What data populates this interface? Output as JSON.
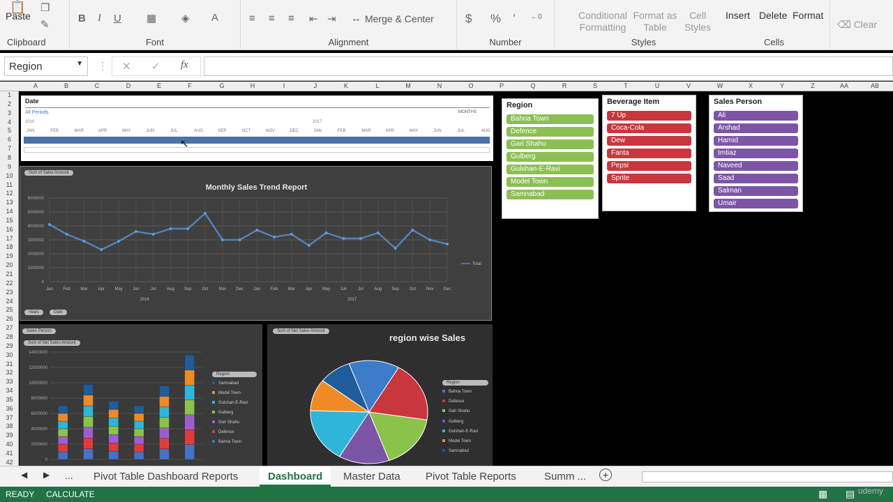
{
  "ribbon": {
    "paste": "Paste",
    "clipboard": "Clipboard",
    "font": "Font",
    "alignment": "Alignment",
    "merge_center": "Merge & Center",
    "number": "Number",
    "currency": "$",
    "percent": "%",
    "comma": "’",
    "conditional1": "Conditional",
    "conditional2": "Formatting",
    "format_table1": "Format as",
    "format_table2": "Table",
    "cell_styles1": "Cell",
    "cell_styles2": "Styles",
    "styles": "Styles",
    "insert": "Insert",
    "delete": "Delete",
    "format": "Format",
    "cells": "Cells",
    "clear": "Clear",
    "bold": "B",
    "italic": "I",
    "underline": "U"
  },
  "formula_bar": {
    "name_box": "Region",
    "cancel": "✕",
    "enter": "✓",
    "fx": "fx",
    "value": ""
  },
  "columns": [
    "A",
    "B",
    "C",
    "D",
    "E",
    "F",
    "G",
    "H",
    "I",
    "J",
    "K",
    "L",
    "M",
    "N",
    "O",
    "P",
    "Q",
    "R",
    "S",
    "T",
    "U",
    "V",
    "W",
    "X",
    "Y",
    "Z",
    "AA",
    "AB"
  ],
  "rows": [
    "1",
    "2",
    "3",
    "4",
    "5",
    "6",
    "7",
    "8",
    "9",
    "10",
    "11",
    "12",
    "13",
    "14",
    "15",
    "16",
    "17",
    "18",
    "19",
    "20",
    "21",
    "22",
    "23",
    "24",
    "25",
    "26",
    "27",
    "28",
    "29",
    "30",
    "31",
    "32",
    "33",
    "34",
    "35",
    "36",
    "37",
    "38",
    "39",
    "40",
    "41",
    "42"
  ],
  "timeline": {
    "title": "Date",
    "periods": "All Periods",
    "unit": "MONTHS",
    "years": [
      "2016",
      "2017"
    ],
    "months": [
      "JAN",
      "FEB",
      "MAR",
      "APR",
      "MAY",
      "JUN",
      "JUL",
      "AUG",
      "SEP",
      "OCT",
      "NOV",
      "DEC",
      "JAN",
      "FEB",
      "MAR",
      "APR",
      "MAY",
      "JUN",
      "JUL",
      "AUG"
    ]
  },
  "line_chart": {
    "tag": "Sum of Sales Amount",
    "title": "Monthly Sales Trend Report",
    "legend": "Total",
    "filters": [
      "Years",
      "Date"
    ]
  },
  "bar_chart": {
    "tags": [
      "Sales Person",
      "Sum of Net Sales Amount"
    ],
    "legend_title": "Region",
    "legend": [
      "Samnabad",
      "Model Town",
      "Gulshan-E-Ravi",
      "Gulberg",
      "Gari Shahu",
      "Defence",
      "Bahria Town"
    ]
  },
  "pie_chart": {
    "tag": "Sum of Net Sales Amount",
    "title": "region wise Sales",
    "legend_title": "Region",
    "legend": [
      "Bahria Town",
      "Defence",
      "Gari Shahu",
      "Gulberg",
      "Gulshan-E-Ravi",
      "Model Town",
      "Samnabad"
    ]
  },
  "slicers": {
    "region": {
      "title": "Region",
      "items": [
        "Bahria Town",
        "Defence",
        "Gari Shahu",
        "Gulberg",
        "Gulshan-E-Ravi",
        "Model Town",
        "Samnabad"
      ],
      "color": "#8bbf53"
    },
    "beverage": {
      "title": "Beverage Item",
      "items": [
        "7 Up",
        "Coca-Cola",
        "Dew",
        "Fanta",
        "Pepsi",
        "Sprite"
      ],
      "color": "#c9363e"
    },
    "salesperson": {
      "title": "Sales Person",
      "items": [
        "Ali",
        "Arshad",
        "Hamid",
        "Imtiaz",
        "Naveed",
        "Saad",
        "Salman",
        "Umair"
      ],
      "color": "#7c55a6"
    }
  },
  "tabs": {
    "items": [
      "Pivot Table Dashboard Reports",
      "Dashboard",
      "Master Data",
      "Pivot Table Reports",
      "Summ ..."
    ],
    "active": "Dashboard",
    "more": "..."
  },
  "status": {
    "ready": "READY",
    "calculate": "CALCULATE",
    "watermark": "udemy"
  },
  "chart_data": [
    {
      "type": "line",
      "title": "Monthly Sales Trend Report",
      "categories": [
        "Jan",
        "Feb",
        "Mar",
        "Apr",
        "May",
        "Jun",
        "Jul",
        "Aug",
        "Sep",
        "Oct",
        "Nov",
        "Dec",
        "Jan",
        "Feb",
        "Mar",
        "Apr",
        "May",
        "Jun",
        "Jul",
        "Aug",
        "Sep",
        "Oct",
        "Nov",
        "Dec"
      ],
      "groups": [
        "2016",
        "2017"
      ],
      "series": [
        {
          "name": "Total",
          "values": [
            4100000,
            3400000,
            2900000,
            2300000,
            2900000,
            3600000,
            3400000,
            3800000,
            3800000,
            4900000,
            3000000,
            3000000,
            3700000,
            3200000,
            3400000,
            2600000,
            3500000,
            3100000,
            3100000,
            3500000,
            2400000,
            3700000,
            3000000,
            2700000
          ]
        }
      ],
      "ylim": [
        0,
        6000000
      ],
      "yticks": [
        "0",
        "1000000",
        "2000000",
        "3000000",
        "4000000",
        "5000000",
        "6000000"
      ]
    },
    {
      "type": "bar",
      "stacked": true,
      "yticks": [
        "0",
        "2000000",
        "4000000",
        "6000000",
        "8000000",
        "10000000",
        "12000000",
        "14000000"
      ],
      "ylim": [
        0,
        14000000
      ],
      "totals": [
        7000000,
        9800000,
        7600000,
        7000000,
        9600000,
        13600000
      ],
      "series_colors": [
        "#4472c4",
        "#e03c3c",
        "#9c5fd0",
        "#8bc34a",
        "#2fb5d9",
        "#f08a24",
        "#1f5c99"
      ]
    },
    {
      "type": "pie",
      "title": "region wise Sales",
      "labels": [
        "Bahria Town",
        "Defence",
        "Gari Shahu",
        "Gulberg",
        "Gulshan-E-Ravi",
        "Model Town",
        "Samnabad"
      ],
      "values": [
        14,
        19,
        17,
        14,
        17,
        10,
        9
      ],
      "colors": [
        "#3d7cc9",
        "#c9363e",
        "#8bc34a",
        "#7c55a6",
        "#2fb5d9",
        "#f08a24",
        "#1f5c99"
      ]
    }
  ]
}
